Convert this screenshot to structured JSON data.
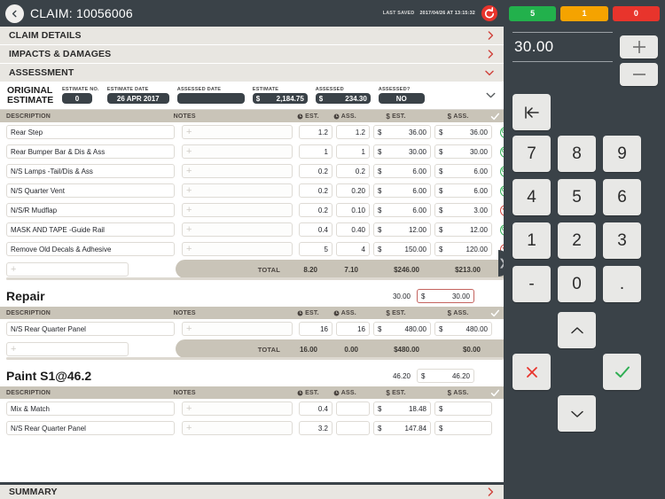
{
  "header": {
    "back_icon": "chevron-left-icon",
    "title": "CLAIM: 10056006",
    "last_saved_label": "LAST SAVED",
    "last_saved_value": "2017/04/26 AT 13:15:32",
    "refresh_icon": "undo-refresh-icon"
  },
  "status_badges": [
    {
      "label": "5",
      "color": "#22b14c",
      "name": "green-count-badge"
    },
    {
      "label": "1",
      "color": "#f5a300",
      "name": "orange-count-badge"
    },
    {
      "label": "0",
      "color": "#e8342c",
      "name": "red-count-badge"
    }
  ],
  "accordions": [
    {
      "label": "CLAIM DETAILS",
      "state": "collapsed",
      "icon": "chevron-right-icon"
    },
    {
      "label": "IMPACTS & DAMAGES",
      "state": "collapsed",
      "icon": "chevron-right-icon"
    },
    {
      "label": "ASSESSMENT",
      "state": "expanded",
      "icon": "chevron-down-icon"
    }
  ],
  "summary_bar": {
    "label": "SUMMARY",
    "icon": "chevron-right-icon"
  },
  "original_estimate": {
    "title_line1": "ORIGINAL",
    "title_line2": "ESTIMATE",
    "collapse_icon": "chevron-down-icon",
    "fields": [
      {
        "label": "ESTIMATE NO.",
        "value": "0",
        "currency": ""
      },
      {
        "label": "ESTIMATE DATE",
        "value": "26 APR 2017",
        "currency": ""
      },
      {
        "label": "ASSESSED DATE",
        "value": "",
        "currency": ""
      },
      {
        "label": "ESTIMATE",
        "value": "2,184.75",
        "currency": "$"
      },
      {
        "label": "ASSESSED",
        "value": "234.30",
        "currency": "$"
      },
      {
        "label": "ASSESSED?",
        "value": "NO",
        "currency": ""
      }
    ]
  },
  "table_columns": {
    "description": "DESCRIPTION",
    "notes": "NOTES",
    "est_hours": "EST.",
    "ass_hours": "ASS.",
    "est_cash": "EST.",
    "ass_cash": "ASS.",
    "check_icon": "check-icon",
    "clock_icon": "clock-icon",
    "dollar_icon": "dollar-icon"
  },
  "add_row_placeholder": "",
  "notes_placeholder": "",
  "total_label": "TOTAL",
  "sections": [
    {
      "name": "original-estimate-items",
      "has_heading": false,
      "heading": "",
      "rate_plain": "",
      "rate_currency": "",
      "rate_value": "",
      "rate_active": false,
      "rows": [
        {
          "description": "Rear Step",
          "notes": "",
          "est_hours": "1.2",
          "ass_hours": "1.2",
          "est_cash": "36.00",
          "ass_cash": "36.00",
          "status": "ok"
        },
        {
          "description": "Rear Bumper Bar & Dis & Ass",
          "notes": "",
          "est_hours": "1",
          "ass_hours": "1",
          "est_cash": "30.00",
          "ass_cash": "30.00",
          "status": "ok"
        },
        {
          "description": "N/S Lamps -Tail/Dis & Ass",
          "notes": "",
          "est_hours": "0.2",
          "ass_hours": "0.2",
          "est_cash": "6.00",
          "ass_cash": "6.00",
          "status": "ok"
        },
        {
          "description": "N/S Quarter Vent",
          "notes": "",
          "est_hours": "0.2",
          "ass_hours": "0.20",
          "est_cash": "6.00",
          "ass_cash": "6.00",
          "status": "ok"
        },
        {
          "description": "N/S/R Mudflap",
          "notes": "",
          "est_hours": "0.2",
          "ass_hours": "0.10",
          "est_cash": "6.00",
          "ass_cash": "3.00",
          "status": "down"
        },
        {
          "description": "MASK AND TAPE -Guide Rail",
          "notes": "",
          "est_hours": "0.4",
          "ass_hours": "0.40",
          "est_cash": "12.00",
          "ass_cash": "12.00",
          "status": "ok"
        },
        {
          "description": "Remove Old Decals & Adhesive",
          "notes": "",
          "est_hours": "5",
          "ass_hours": "4",
          "est_cash": "150.00",
          "ass_cash": "120.00",
          "status": "down"
        }
      ],
      "totals": {
        "est_hours": "8.20",
        "ass_hours": "7.10",
        "est_cash": "$246.00",
        "ass_cash": "$213.00"
      }
    },
    {
      "name": "repair-section",
      "has_heading": true,
      "heading": "Repair",
      "rate_plain": "30.00",
      "rate_currency": "$",
      "rate_value": "30.00",
      "rate_active": true,
      "rows": [
        {
          "description": "N/S Rear Quarter Panel",
          "notes": "",
          "est_hours": "16",
          "ass_hours": "16",
          "est_cash": "480.00",
          "ass_cash": "480.00",
          "status": "none"
        }
      ],
      "totals": {
        "est_hours": "16.00",
        "ass_hours": "0.00",
        "est_cash": "$480.00",
        "ass_cash": "$0.00"
      }
    },
    {
      "name": "paint-section",
      "has_heading": true,
      "heading": "Paint S1@46.2",
      "rate_plain": "46.20",
      "rate_currency": "$",
      "rate_value": "46.20",
      "rate_active": false,
      "rows": [
        {
          "description": "Mix & Match",
          "notes": "",
          "est_hours": "0.4",
          "ass_hours": "",
          "est_cash": "18.48",
          "ass_cash": "",
          "status": "none"
        }
      ],
      "totals": null
    }
  ],
  "keypad": {
    "display_value": "30.00",
    "plus_label": "+",
    "minus_label": "−",
    "backspace_icon": "backspace-left-icon",
    "keys": [
      "7",
      "8",
      "9",
      "4",
      "5",
      "6",
      "1",
      "2",
      "3",
      "-",
      "0",
      "."
    ],
    "up_icon": "chevron-up-icon",
    "down_icon": "chevron-down-icon",
    "cancel_icon": "cross-icon",
    "confirm_icon": "check-icon"
  },
  "resize_handle": {
    "icon": "drag-handle-icon"
  }
}
